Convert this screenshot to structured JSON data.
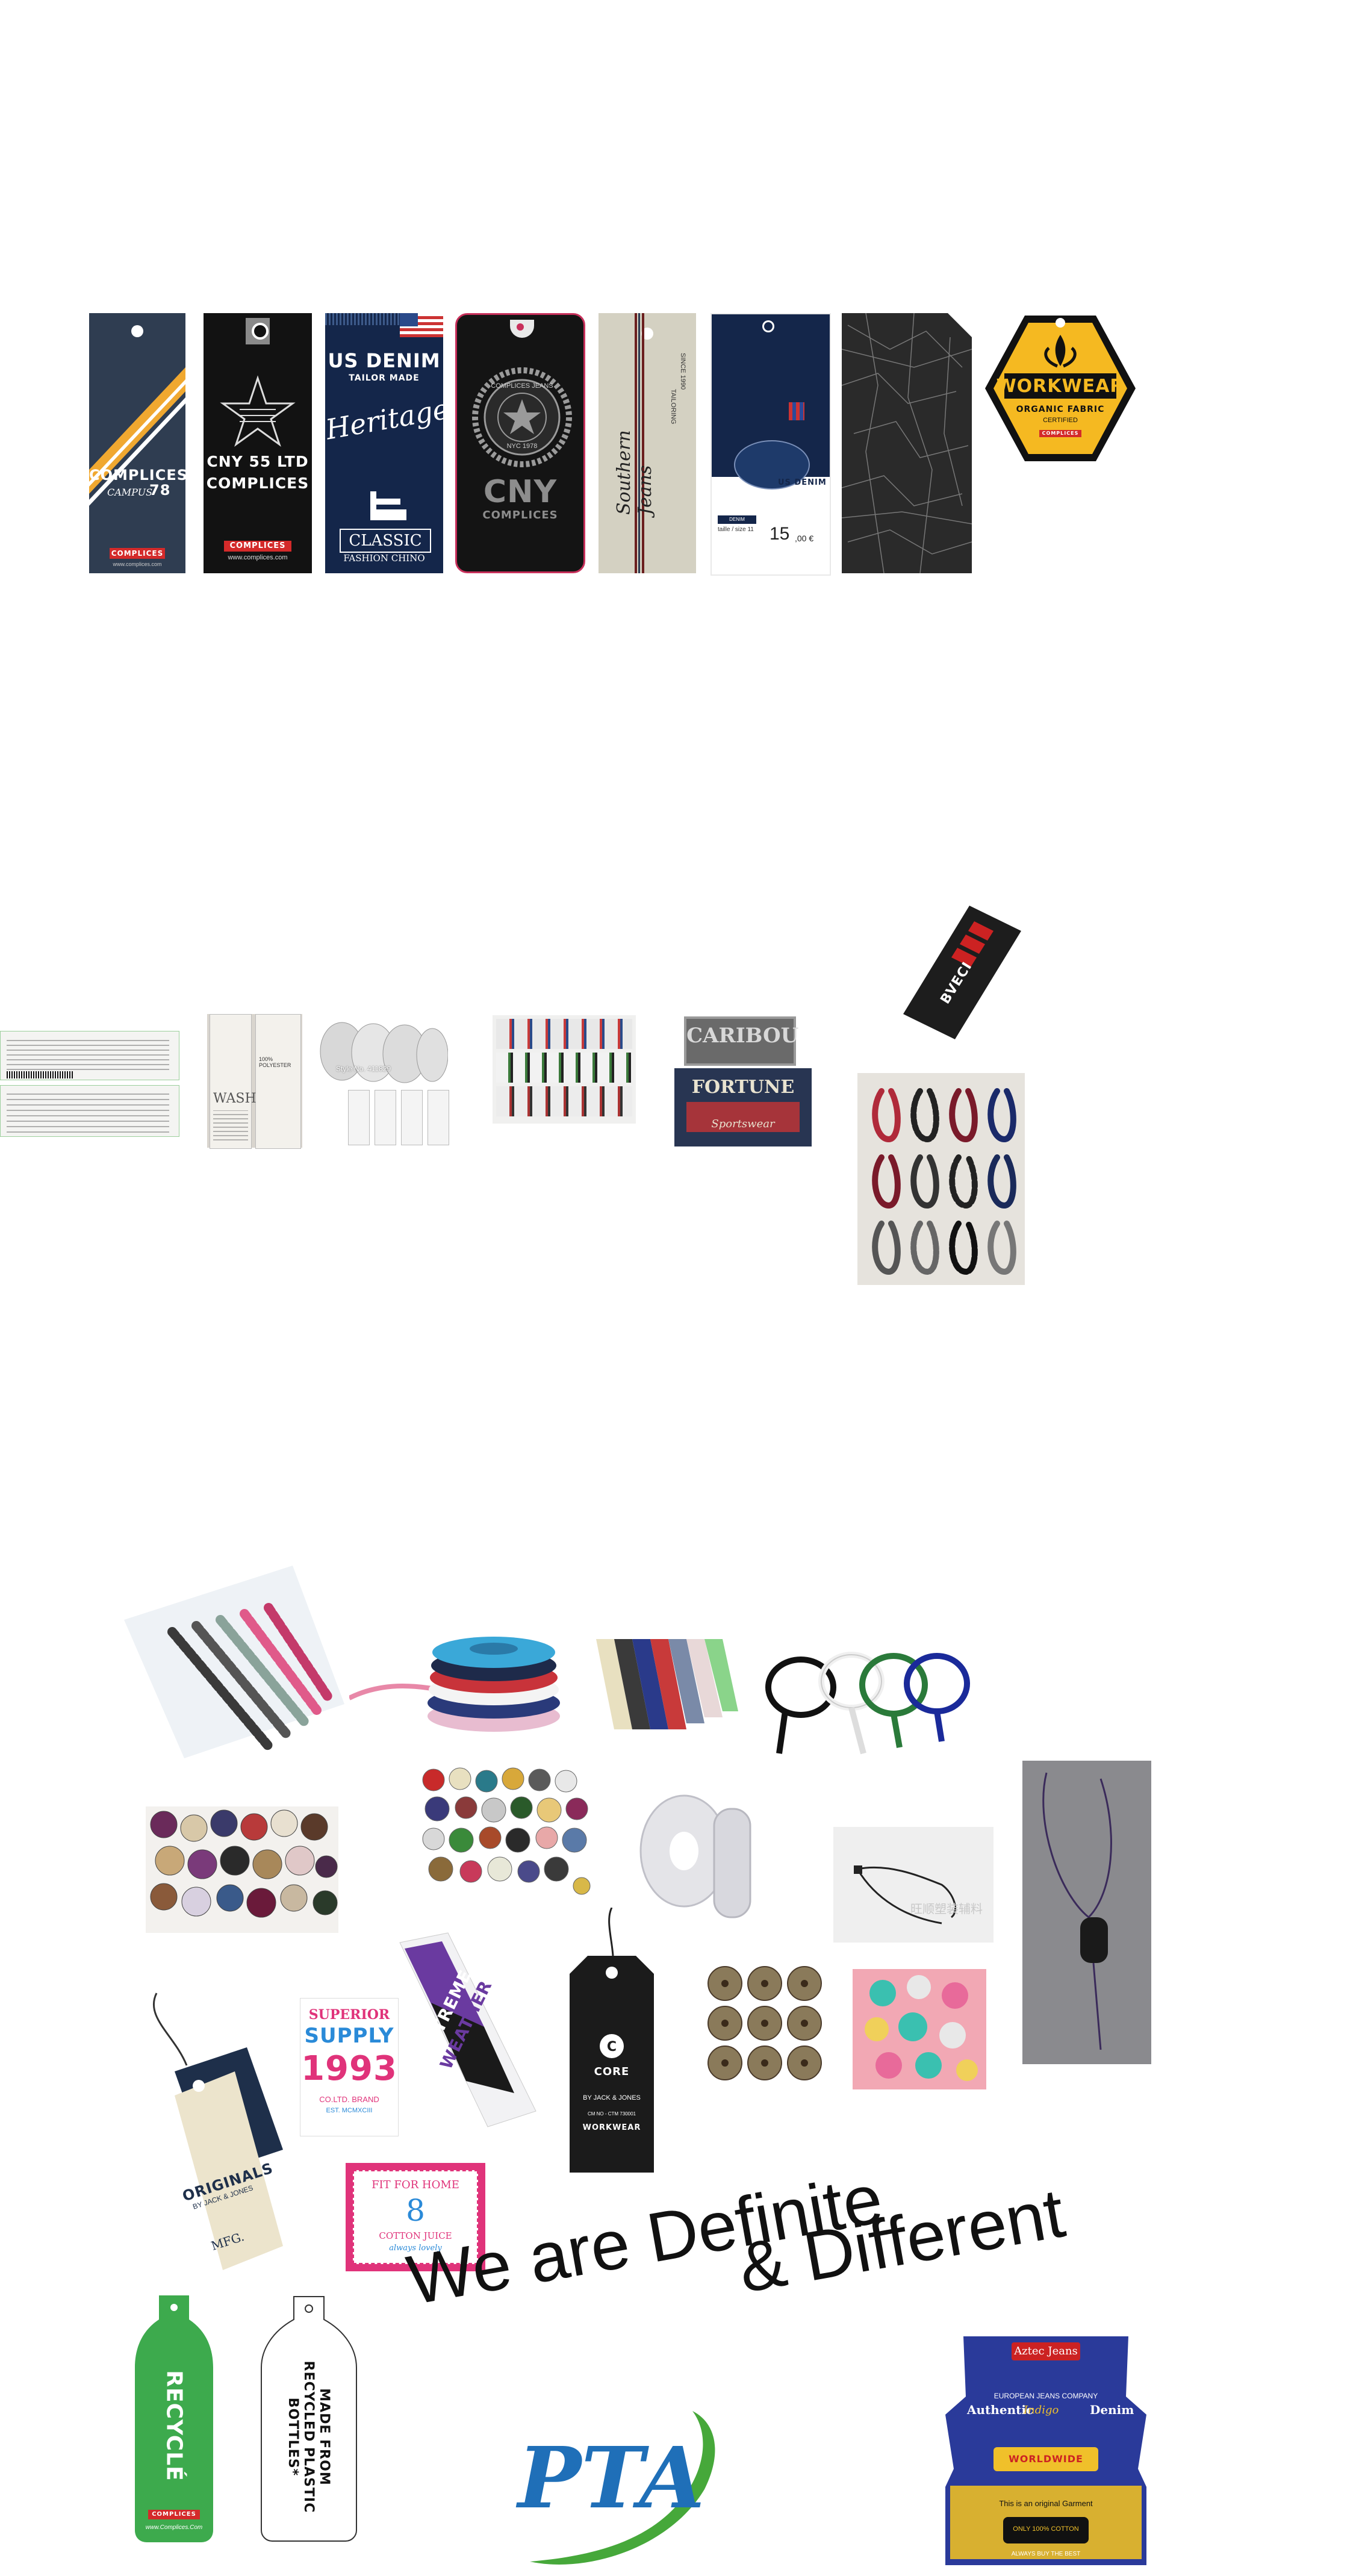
{
  "hangtags": {
    "tag1": {
      "brand": "COMPLICES",
      "sub": "CAMPUS",
      "num": "78",
      "badge": "COMPLICES",
      "url": "www.complices.com"
    },
    "tag2": {
      "line1": "CNY 55 LTD",
      "line2": "COMPLICES",
      "badge": "COMPLICES",
      "url": "www.complices.com"
    },
    "tag3": {
      "title": "US DENIM",
      "sub": "TAILOR MADE",
      "script": "Heritage",
      "classic": "CLASSIC",
      "classic_sub": "FASHION CHINO"
    },
    "tag4": {
      "seal_top": "COMPLICES JEANS",
      "seal_bottom": "NYC 1978",
      "big": "CNY",
      "small": "COMPLICES"
    },
    "tag5": {
      "script": "Southern Jeans",
      "since": "SINCE 1990",
      "tailoring": "TAILORING"
    },
    "tag6": {
      "brand": "US DENIM",
      "fit": "DENIM STRETCH",
      "size": "taille / size 11",
      "price": "15",
      "price_cents": ",00 €"
    },
    "tag8": {
      "title": "WORKWEAR",
      "line1": "ORGANIC FABRIC",
      "line2": "CERTIFIED",
      "badge": "COMPLICES"
    }
  },
  "labels": {
    "woven_tag": "BVECI",
    "roll_text": "Style No. 411829",
    "caribou": "CARIBOU",
    "fortune": "FORTUNE",
    "sportswear": "Sportswear",
    "polyester": "100% POLYESTER",
    "wash": "WASH"
  },
  "accessories": {
    "watermark": "旺顺塑装辅料",
    "originals": "ORIGINALS",
    "originals_by": "BY JACK & JONES",
    "mfg": "MFG.",
    "superior": "SUPERIOR",
    "supply": "SUPPLY",
    "year": "1993",
    "supply_sub": "CO.LTD. BRAND",
    "supply_est": "EST. MCMXCIII",
    "extreme": "EXTREME",
    "weather": "WEATHER",
    "core": "CORE",
    "core_by": "BY JACK & JONES",
    "core_id": "CM NO - CTM 730001",
    "workwear": "WORKWEAR",
    "fit_home": "FIT FOR HOME",
    "eight": "8",
    "juice": "COTTON JUICE",
    "lovely": "always lovely"
  },
  "slogan": {
    "line1": "We are Definite",
    "line2": "& Different"
  },
  "recycle": {
    "green_text": "RECYCLÉ",
    "green_badge": "COMPLICES",
    "green_url": "www.Complices.Com",
    "white_text": "MADE FROM RECYCLED PLASTIC BOTTLES*"
  },
  "logo": {
    "text": "PTA"
  },
  "aztec": {
    "brand": "Aztec Jeans",
    "company": "EUROPEAN JEANS COMPANY",
    "authentic": "Authentic",
    "indigo": "Indigo",
    "denim": "Denim",
    "worldwide": "WORLDWIDE",
    "original": "This is an original Garment",
    "cotton": "ONLY 100% COTTON",
    "bottom": "ALWAYS BUY THE BEST"
  },
  "colors": {
    "navy": "#2b3a52",
    "black": "#111111",
    "denim": "#14243f",
    "yellow": "#f5b921",
    "green": "#3daa4d",
    "pink": "#e0337a",
    "blue": "#1f6fb8"
  }
}
